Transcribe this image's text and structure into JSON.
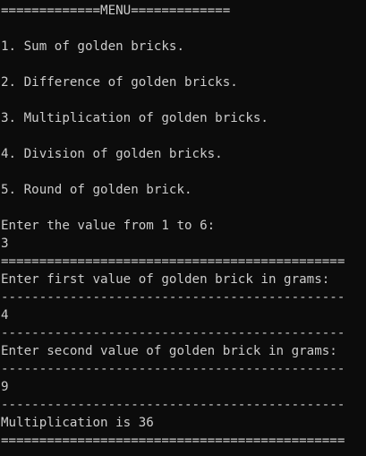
{
  "console": {
    "menu_header": "=============MENU=============",
    "menu_items": [
      "1. Sum of golden bricks.",
      "2. Difference of golden bricks.",
      "3. Multiplication of golden bricks.",
      "4. Division of golden bricks.",
      "5. Round of golden brick."
    ],
    "choice_prompt": "Enter the value from 1 to 6:",
    "choice_value": "3",
    "double_rule": "=============================================",
    "first_prompt": "Enter first value of golden brick in grams:",
    "single_rule": "---------------------------------------------",
    "first_value": "4",
    "second_prompt": "Enter second value of golden brick in grams:",
    "second_value": "9",
    "result_text": "Multiplication is 36"
  },
  "colors": {
    "background": "#0c0c0c",
    "text": "#cccccc"
  }
}
